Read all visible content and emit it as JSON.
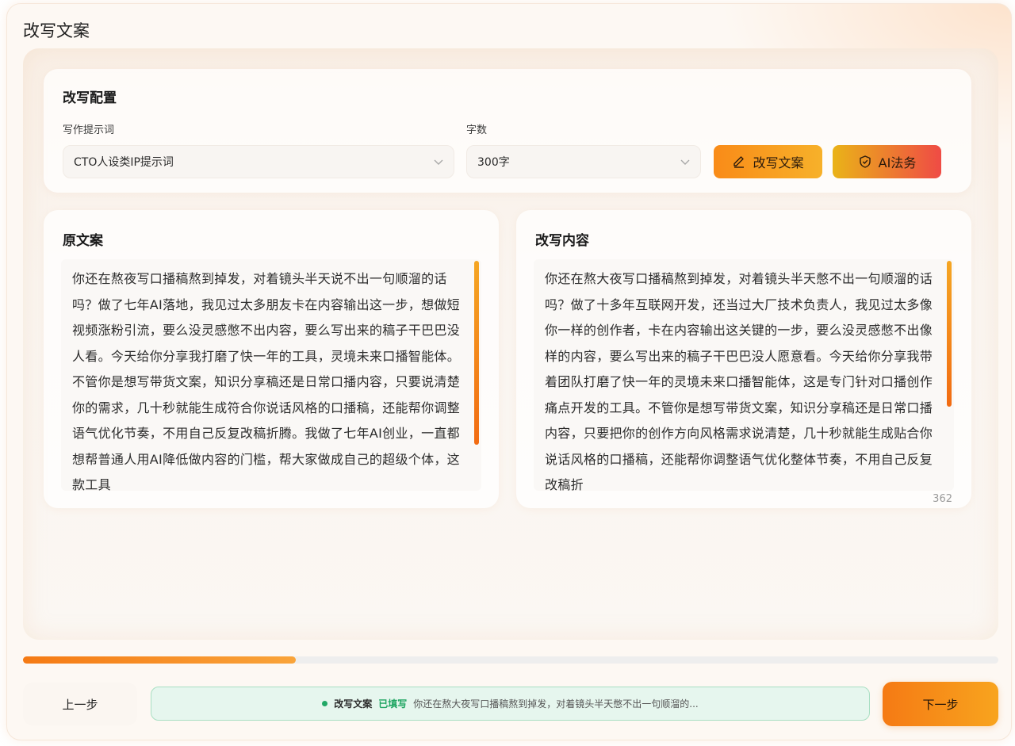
{
  "page": {
    "title": "改写文案"
  },
  "config": {
    "title": "改写配置",
    "prompt_label": "写作提示词",
    "prompt_value": "CTO人设类IP提示词",
    "wordcount_label": "字数",
    "wordcount_value": "300字",
    "rewrite_button": "改写文案",
    "legal_button": "AI法务"
  },
  "source": {
    "title": "原文案",
    "text": "你还在熬夜写口播稿熬到掉发，对着镜头半天说不出一句顺溜的话吗？做了七年AI落地，我见过太多朋友卡在内容输出这一步，想做短视频涨粉引流，要么没灵感憋不出内容，要么写出来的稿子干巴巴没人看。今天给你分享我打磨了快一年的工具，灵境未来口播智能体。不管你是想写带货文案，知识分享稿还是日常口播内容，只要说清楚你的需求，几十秒就能生成符合你说话风格的口播稿，还能帮你调整语气优化节奏，不用自己反复改稿折腾。我做了七年AI创业，一直都想帮普通人用AI降低做内容的门槛，帮大家做成自己的超级个体，这款工具"
  },
  "result": {
    "title": "改写内容",
    "text": "你还在熬大夜写口播稿熬到掉发，对着镜头半天憋不出一句顺溜的话吗？做了十多年互联网开发，还当过大厂技术负责人，我见过太多像你一样的创作者，卡在内容输出这关键的一步，要么没灵感憋不出像样的内容，要么写出来的稿子干巴巴没人愿意看。今天给你分享我带着团队打磨了快一年的灵境未来口播智能体，这是专门针对口播创作痛点开发的工具。不管你是想写带货文案，知识分享稿还是日常口播内容，只要把你的创作方向风格需求说清楚，几十秒就能生成贴合你说话风格的口播稿，还能帮你调整语气优化整体节奏，不用自己反复改稿折",
    "char_count": "362"
  },
  "progress": {
    "fraction": 0.28
  },
  "footer": {
    "prev_button": "上一步",
    "status_step": "改写文案",
    "status_badge": "已填写",
    "status_preview": "你还在熬大夜写口播稿熬到掉发，对着镜头半天憋不出一句顺溜的...",
    "next_button": "下一步"
  }
}
